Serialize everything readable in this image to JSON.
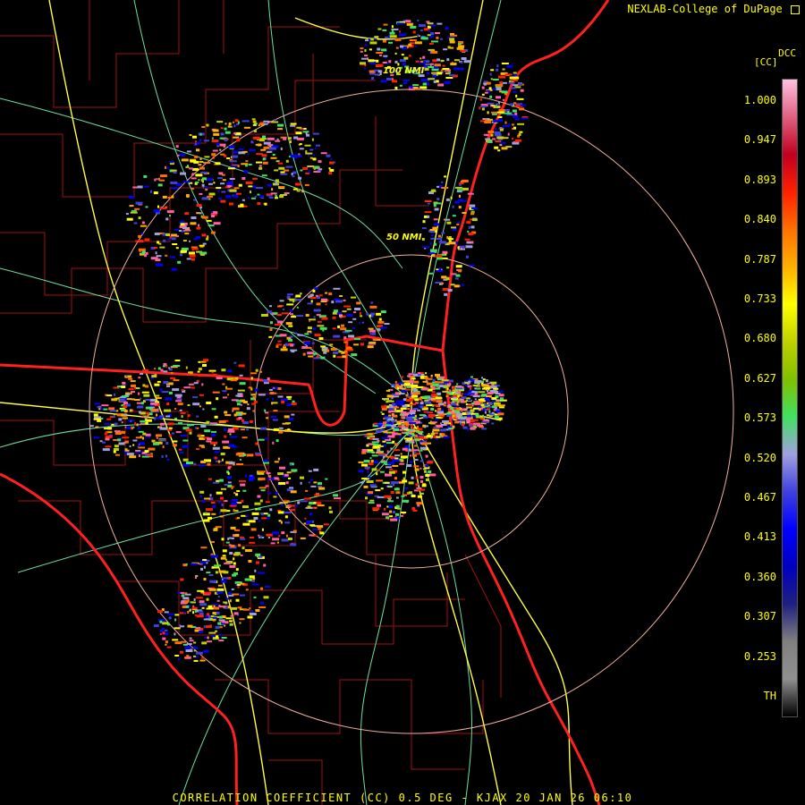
{
  "header": {
    "credit": "NEXLAB-College of DuPage",
    "credit_icon": "map-icon",
    "product_code": "DCC",
    "unit": "[CC]"
  },
  "footer": {
    "caption": "CORRELATION COEFFICIENT (CC) 0.5 DEG - KJAX 20 JAN 26 06:10"
  },
  "map": {
    "radar_site": "KJAX",
    "range_rings": [
      {
        "label": "50 NMI"
      },
      {
        "label": "100 NMI"
      }
    ],
    "colors": {
      "background": "#000000",
      "county_lines": "#a01010",
      "state_lines": "#ff2020",
      "highways": "#ffff40",
      "roads": "#70e0a0",
      "range_rings": "#f0b0a0"
    }
  },
  "legend": {
    "ticks": [
      "1.000",
      "0.947",
      "0.893",
      "0.840",
      "0.787",
      "0.733",
      "0.680",
      "0.627",
      "0.573",
      "0.520",
      "0.467",
      "0.413",
      "0.360",
      "0.307",
      "0.253",
      "TH"
    ],
    "color_stops": [
      "#ffc0e0",
      "#e06080",
      "#c00020",
      "#ff2000",
      "#ff7000",
      "#ffb000",
      "#ffff00",
      "#c0d000",
      "#80c000",
      "#40e060",
      "#a0a0e0",
      "#4040e0",
      "#0000ff",
      "#0000c0",
      "#202080",
      "#808080",
      "#909090",
      "#000000"
    ]
  }
}
